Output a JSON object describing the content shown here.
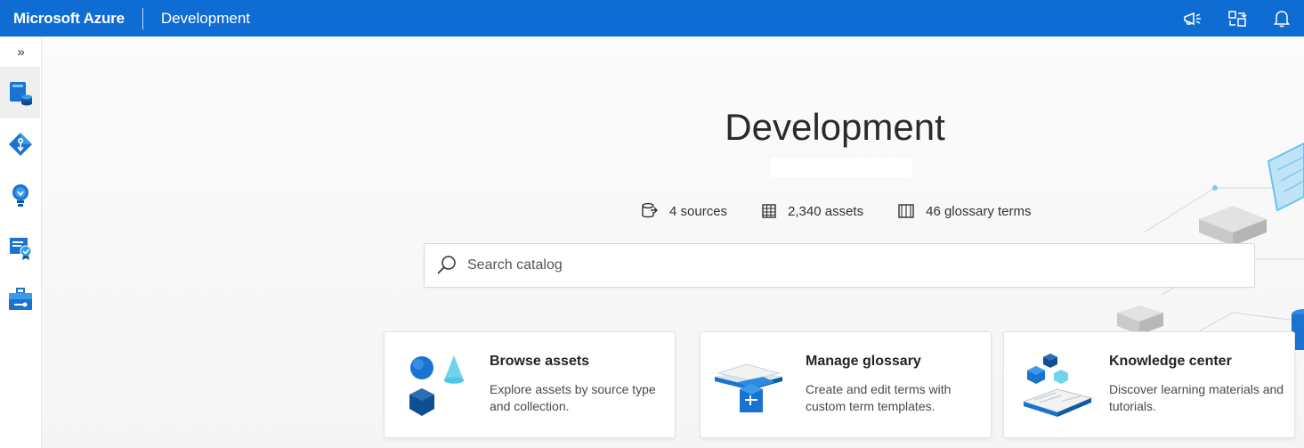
{
  "topbar": {
    "brand": "Microsoft Azure",
    "context": "Development",
    "icons": [
      "megaphone-icon",
      "directory-switch-icon",
      "bell-icon"
    ]
  },
  "rail": {
    "expand_glyph": "»",
    "items": [
      "data-map-icon",
      "data-catalog-icon",
      "insights-icon",
      "policy-icon",
      "management-icon"
    ]
  },
  "main": {
    "title": "Development",
    "stats": [
      {
        "value": "4 sources",
        "icon": "sources-icon"
      },
      {
        "value": "2,340 assets",
        "icon": "assets-grid-icon"
      },
      {
        "value": "46 glossary terms",
        "icon": "book-icon"
      }
    ],
    "search": {
      "placeholder": "Search catalog"
    },
    "cards": [
      {
        "title": "Browse assets",
        "description": "Explore assets by source type and collection."
      },
      {
        "title": "Manage glossary",
        "description": "Create and edit terms with custom term templates."
      },
      {
        "title": "Knowledge center",
        "description": "Discover learning materials and tutorials."
      }
    ]
  },
  "colors": {
    "topbar": "#0f6cd3",
    "accent": "#1f7ad4"
  }
}
